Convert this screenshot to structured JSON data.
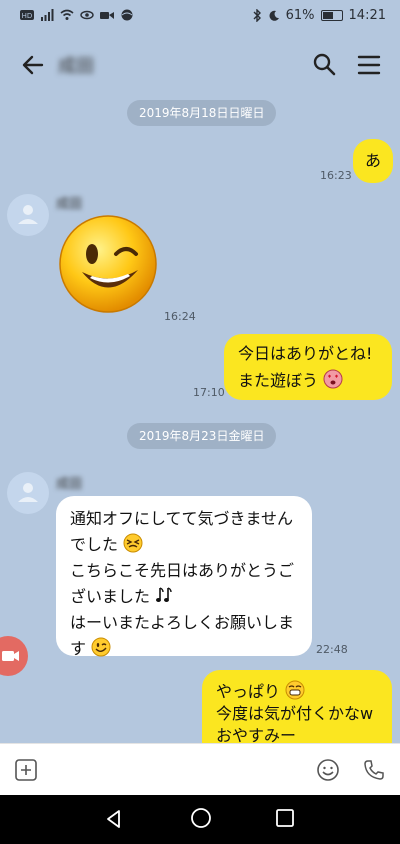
{
  "status_bar": {
    "battery_text": "61%",
    "time": "14:21",
    "battery_level": 0.61
  },
  "header": {
    "contact_name": "成田",
    "icons": [
      "back-arrow-icon",
      "search-icon",
      "menu-icon"
    ]
  },
  "colors": {
    "background": "#b4c7de",
    "outgoing_bubble": "#fbe620",
    "incoming_bubble": "#ffffff",
    "date_pill": "#9fb1c6"
  },
  "messages": {
    "date1": "2019年8月18日日曜日",
    "m1": {
      "text": "あ",
      "time": "16:23"
    },
    "m2": {
      "sender": "成田",
      "time": "16:24",
      "sticker": "wink-emoji"
    },
    "m3": {
      "line1": "今日はありがとね!",
      "line2": "また遊ぼう",
      "time": "17:10"
    },
    "date2": "2019年8月23日金曜日",
    "m4": {
      "sender": "成田",
      "line1": "通知オフにしてて気づきません",
      "line2": "でした",
      "line3": "こちらこそ先日はありがとうご",
      "line4": "ざいました",
      "line5": "はーいまたよろしくお願いしま",
      "line6": "す",
      "time": "22:48"
    },
    "m5": {
      "line1": "やっぱり",
      "line2": "今度は気が付くかなw",
      "line3": "おやすみー"
    }
  },
  "input_bar": {
    "icons": [
      "plus-icon",
      "emoji-icon",
      "phone-icon"
    ]
  },
  "nav_bar": {
    "icons": [
      "nav-back-icon",
      "nav-home-icon",
      "nav-recent-icon"
    ]
  }
}
